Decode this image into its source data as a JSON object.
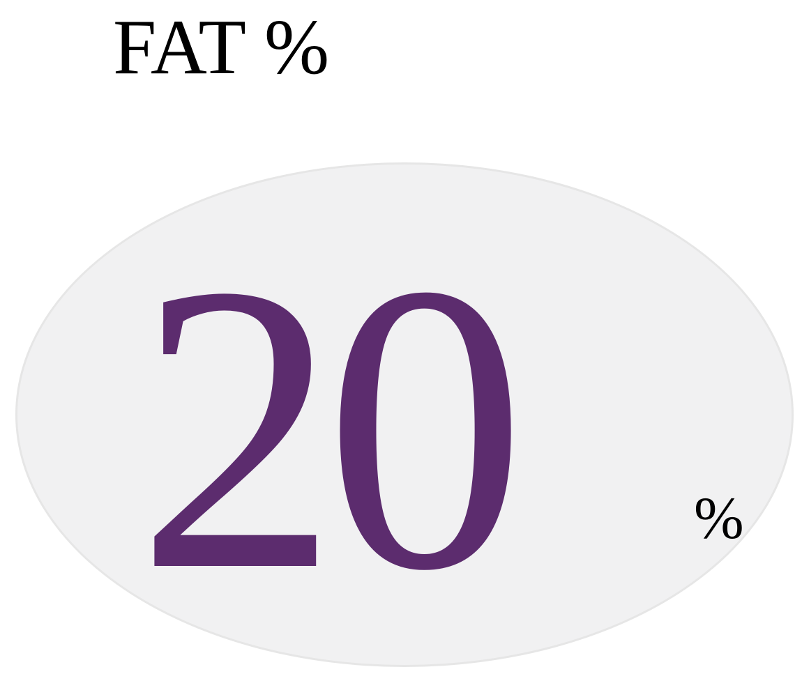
{
  "title": "FAT %",
  "badge": {
    "value": "20",
    "unit": "%",
    "fill_color": "#f1f1f2",
    "value_color": "#5c2c6e"
  }
}
